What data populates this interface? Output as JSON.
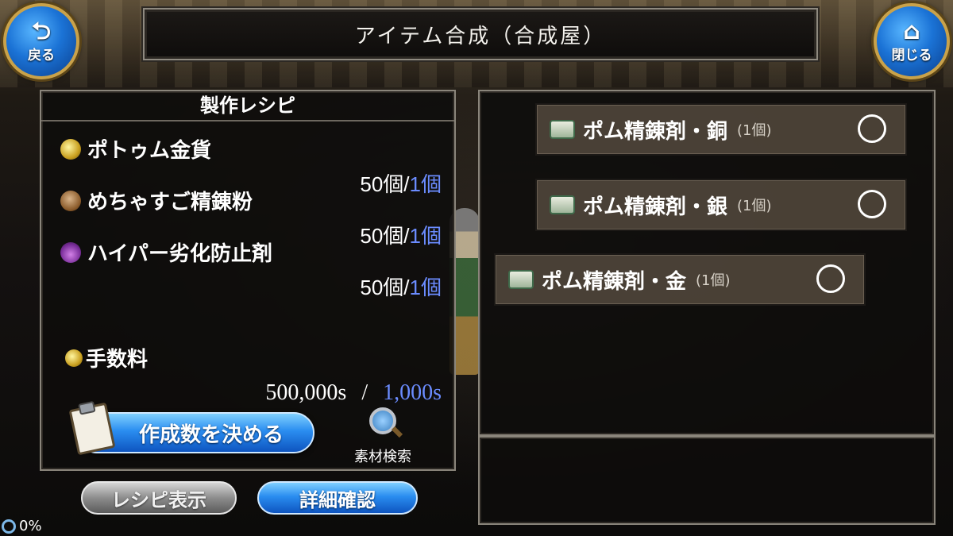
{
  "header": {
    "title": "アイテム合成（合成屋）",
    "back_label": "戻る",
    "close_label": "閉じる"
  },
  "recipe": {
    "title": "製作レシピ",
    "materials": [
      {
        "name": "ポトゥム金貨",
        "have": "50個/",
        "need": "1個",
        "icon": "gold-coin-icon"
      },
      {
        "name": "めちゃすご精錬粉",
        "have": "50個/",
        "need": "1個",
        "icon": "powder-bag-icon"
      },
      {
        "name": "ハイパー劣化防止剤",
        "have": "50個/",
        "need": "1個",
        "icon": "potion-icon"
      }
    ],
    "fee": {
      "label": "手数料",
      "have": "500,000s",
      "separator": "/",
      "need": "1,000s"
    },
    "make_button": "作成数を決める",
    "search_label": "素材検索"
  },
  "bottom": {
    "recipe_button": "レシピ表示",
    "detail_button": "詳細確認"
  },
  "choices": [
    {
      "name": "ポム精錬剤・銅",
      "qty": "(1個)"
    },
    {
      "name": "ポム精錬剤・銀",
      "qty": "(1個)"
    },
    {
      "name": "ポム精錬剤・金",
      "qty": "(1個)"
    }
  ],
  "status": {
    "progress": "0%"
  },
  "colors": {
    "accent_blue": "#6b8cff",
    "button_blue": "#2a8df0"
  }
}
